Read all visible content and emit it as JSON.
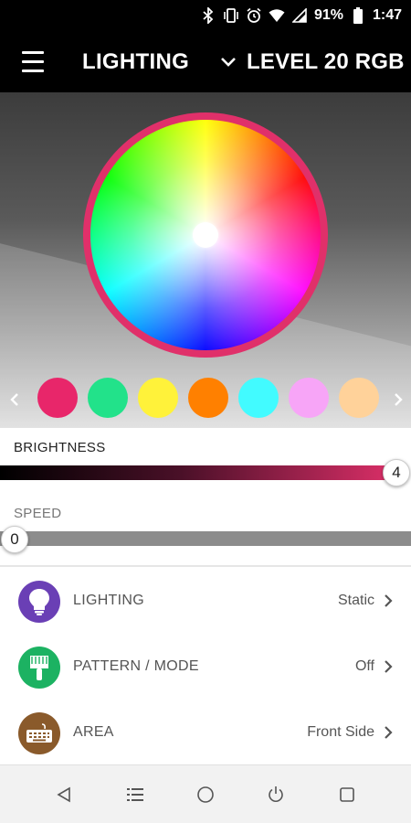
{
  "status_bar": {
    "battery": "91%",
    "time": "1:47",
    "icons": [
      "bluetooth-icon",
      "vibrate-icon",
      "alarm-icon",
      "wifi-icon",
      "signal-icon",
      "battery-icon"
    ]
  },
  "app_bar": {
    "title": "LIGHTING",
    "device_name": "LEVEL 20 RGB",
    "menu_icon": "hamburger-menu-icon",
    "dropdown_icon": "chevron-down-icon"
  },
  "color_picker": {
    "ring_color": "#e0306a",
    "selected": "white",
    "presets": [
      "#e8266a",
      "#22e28a",
      "#fff23a",
      "#ff8000",
      "#42fbff",
      "#f7a5f7",
      "#ffd29a"
    ]
  },
  "brightness": {
    "label": "BRIGHTNESS",
    "value": "4",
    "accent": "#e0306a"
  },
  "speed": {
    "label": "SPEED",
    "value": "0"
  },
  "settings": [
    {
      "label": "LIGHTING",
      "value": "Static",
      "icon": "lightbulb-icon",
      "icon_color": "#6a3fb5"
    },
    {
      "label": "PATTERN / MODE",
      "value": "Off",
      "icon": "paint-brush-icon",
      "icon_color": "#1cb262"
    },
    {
      "label": "AREA",
      "value": "Front Side",
      "icon": "keyboard-icon",
      "icon_color": "#8a5a2b"
    }
  ],
  "nav_bar": {
    "buttons": [
      "back-icon",
      "menu-list-icon",
      "home-icon",
      "power-icon",
      "recents-icon"
    ]
  }
}
